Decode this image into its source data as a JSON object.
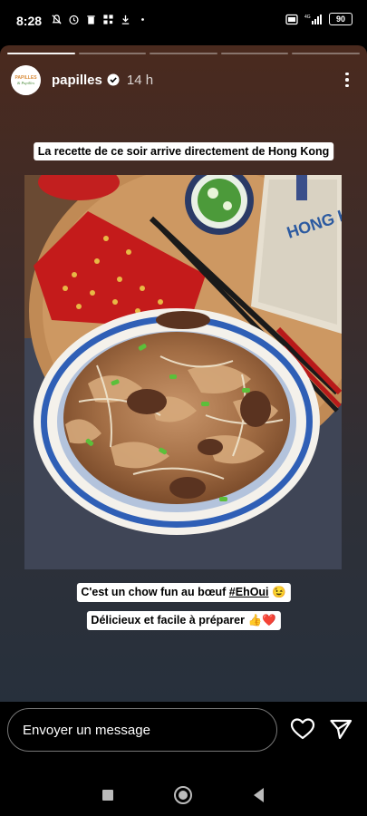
{
  "status_bar": {
    "time": "8:28",
    "battery": "90",
    "network": "4G"
  },
  "story": {
    "segments": 5,
    "active_segment": 1,
    "username": "papilles",
    "avatar_text": "PAPILLES & Pupilles",
    "verified": true,
    "age": "14 h",
    "captions": {
      "top": "La recette de ce soir arrive directement de Hong Kong",
      "middle_prefix": "C'est un chow fun au bœuf ",
      "middle_hashtag": "#EhOui",
      "middle_emoji": "😉",
      "bottom_text": "Délicieux et facile à préparer ",
      "bottom_emoji": "👍❤️"
    },
    "photo_label": "HONG KONG"
  },
  "message_bar": {
    "placeholder": "Envoyer un message"
  },
  "icons": {
    "heart": "heart-icon",
    "send": "send-icon",
    "more": "more-options-icon"
  }
}
